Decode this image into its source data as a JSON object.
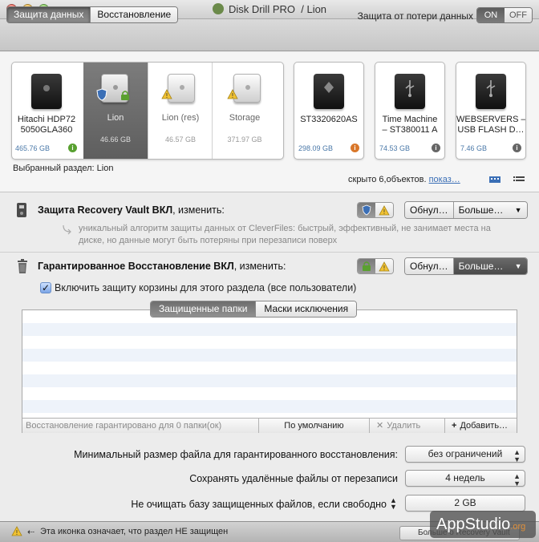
{
  "window": {
    "title": "Disk Drill PRO",
    "subtitle": "/ Lion"
  },
  "toolbar": {
    "tabs": [
      {
        "label": "Защита данных",
        "active": true
      },
      {
        "label": "Восстановление",
        "active": false
      }
    ],
    "protection_label": "Защита от потери данных",
    "toggle_on": "ON",
    "toggle_off": "OFF"
  },
  "disks": {
    "main": {
      "name_line1": "Hitachi HDP72",
      "name_line2": "5050GLA360",
      "size": "465.76 GB"
    },
    "partitions": [
      {
        "name": "Lion",
        "size": "46.66 GB",
        "selected": true
      },
      {
        "name": "Lion (res)",
        "size": "46.57 GB",
        "selected": false
      },
      {
        "name": "Storage",
        "size": "371.97 GB",
        "selected": false
      }
    ],
    "others": [
      {
        "name_line1": "ST3320620AS",
        "name_line2": "",
        "size": "298.09 GB"
      },
      {
        "name_line1": "Time Machine",
        "name_line2": "– ST380011 A",
        "size": "74.53 GB"
      },
      {
        "name_line1": "WEBSERVERS –",
        "name_line2": "USB FLASH D…",
        "size": "7.46 GB"
      }
    ],
    "selected_label": "Выбранный раздел: Lion",
    "hidden_text": "скрыто 6,объектов.",
    "hidden_link": "показ…"
  },
  "vault": {
    "title": "Защита Recovery Vault ВКЛ",
    "change": ", изменить:",
    "reset_label": "Обнул…",
    "more_label": "Больше…",
    "description": "уникальный алгоритм защиты данных от CleverFiles: быстрый, эффективный, не занимает места на диске, но данные могут быть потеряны при перезаписи поверх"
  },
  "guaranteed": {
    "title": "Гарантированное Восстановление ВКЛ",
    "change": ", изменить:",
    "reset_label": "Обнул…",
    "more_label": "Больше…",
    "checkbox_label": "Включить защиту корзины для этого раздела (все пользователи)",
    "tabs": [
      {
        "label": "Защищенные папки",
        "active": true
      },
      {
        "label": "Маски исключения",
        "active": false
      }
    ],
    "footer_status": "Восстановление гарантировано для 0 папки(ок)",
    "default_button": "По умолчанию",
    "delete_button": "Удалить",
    "add_button": "Добавить…"
  },
  "settings": [
    {
      "label": "Минимальный размер файла для гарантированного восстановления:",
      "value": "без ограничений"
    },
    {
      "label": "Сохранять удалённые файлы от перезаписи",
      "value": "4 недель"
    },
    {
      "label": "Не очищать базу защищенных файлов, если свободно",
      "value": "2 GB"
    }
  ],
  "status": {
    "text": "Эта иконка означает, что раздел НЕ защищен",
    "button": "Больше о Recovery Vault"
  },
  "watermark": {
    "text": "AppStudio",
    "suffix": ".org"
  },
  "colors": {
    "accent": "#3b6fb6",
    "warning": "#f1c232",
    "selected_partition": "#6e6e6e",
    "list_stripe": "#eef3fa"
  }
}
